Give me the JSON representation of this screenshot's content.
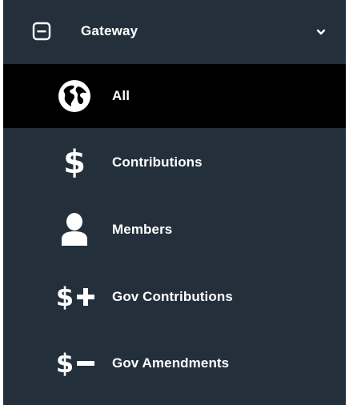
{
  "nav": {
    "header": {
      "title": "Gateway",
      "collapse_icon": "minus-square-icon",
      "chevron_icon": "chevron-down-icon"
    },
    "items": [
      {
        "label": "All",
        "icon": "globe-icon",
        "active": true
      },
      {
        "label": "Contributions",
        "icon": "dollar-icon",
        "active": false
      },
      {
        "label": "Members",
        "icon": "user-icon",
        "active": false
      },
      {
        "label": "Gov Contributions",
        "icon": "dollar-plus-icon",
        "active": false
      },
      {
        "label": "Gov Amendments",
        "icon": "dollar-minus-icon",
        "active": false
      }
    ],
    "colors": {
      "background": "#23303b",
      "active_background": "#000000",
      "text": "#ffffff"
    }
  }
}
